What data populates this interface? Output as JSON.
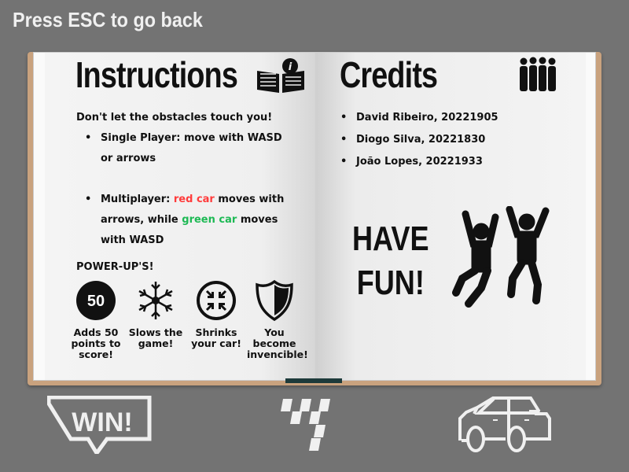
{
  "header": {
    "back_hint": "Press ESC to go back"
  },
  "instructions": {
    "title": "Instructions",
    "intro": "Don't let the obstacles touch you!",
    "single_player": "Single Player: move with WASD or arrows",
    "multi_prefix": "Multiplayer: ",
    "multi_red": "red car",
    "multi_mid": " moves with arrows, while ",
    "multi_green": "green car",
    "multi_suffix": " moves with WASD",
    "powerups_title": "POWER-UP'S!",
    "powerups": [
      {
        "icon": "fifty-points-icon",
        "badge": "50",
        "label": "Adds 50 points to score!"
      },
      {
        "icon": "snowflake-icon",
        "label": "Slows the game!"
      },
      {
        "icon": "shrink-icon",
        "label": "Shrinks your car!"
      },
      {
        "icon": "shield-icon",
        "label": "You become invencible!"
      }
    ]
  },
  "credits": {
    "title": "Credits",
    "authors": [
      "David Ribeiro, 20221905",
      "Diogo Silva, 20221830",
      "João Lopes, 20221933"
    ],
    "fun_line1": "HAVE",
    "fun_line2": "FUN!"
  },
  "footer": {
    "win_badge": "WIN!"
  },
  "colors": {
    "red": "#ff3b3b",
    "green": "#1db954",
    "background": "#737373"
  }
}
